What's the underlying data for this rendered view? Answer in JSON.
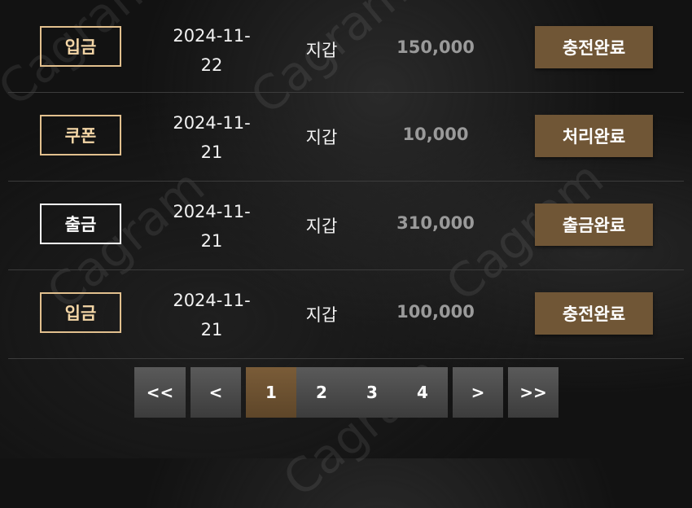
{
  "transactions": [
    {
      "type": "입금",
      "type_style": "in",
      "date_line1": "2024-11-",
      "date_line2": "22",
      "wallet": "지갑",
      "amount": "150,000",
      "status": "충전완료"
    },
    {
      "type": "쿠폰",
      "type_style": "in",
      "date_line1": "2024-11-",
      "date_line2": "21",
      "wallet": "지갑",
      "amount": "10,000",
      "status": "처리완료"
    },
    {
      "type": "출금",
      "type_style": "out",
      "date_line1": "2024-11-",
      "date_line2": "21",
      "wallet": "지갑",
      "amount": "310,000",
      "status": "출금완료"
    },
    {
      "type": "입금",
      "type_style": "in",
      "date_line1": "2024-11-",
      "date_line2": "21",
      "wallet": "지갑",
      "amount": "100,000",
      "status": "충전완료"
    }
  ],
  "pagination": {
    "first": "<<",
    "prev": "<",
    "pages": [
      "1",
      "2",
      "3",
      "4"
    ],
    "current": "1",
    "next": ">",
    "last": ">>"
  },
  "watermark": "Cagram",
  "colors": {
    "accent": "#705636",
    "badge_in_border": "#e2c08e",
    "badge_out_border": "#ffffff",
    "amount": "#9a9a9a",
    "background": "#121212"
  }
}
